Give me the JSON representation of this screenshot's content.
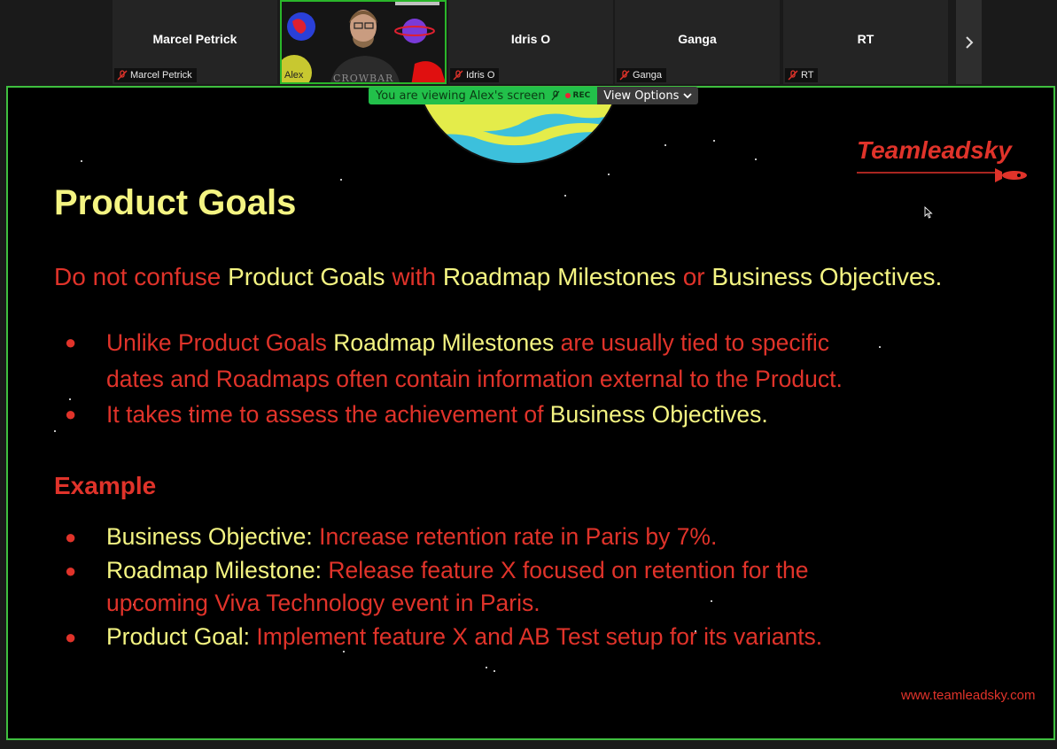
{
  "participants": [
    {
      "name": "Marcel Petrick",
      "tag": "Marcel Petrick"
    },
    {
      "name": "Alex",
      "tag": "Alex"
    },
    {
      "name": "Idris O",
      "tag": "Idris O"
    },
    {
      "name": "Ganga",
      "tag": "Ganga"
    },
    {
      "name": "RT",
      "tag": "RT"
    }
  ],
  "video_shirt_text": "CROWBAR",
  "banner": {
    "viewing": "You are viewing Alex's screen",
    "rec": "REC",
    "view_options": "View Options"
  },
  "slide": {
    "title": "Product Goals",
    "intro": [
      "Do not confuse ",
      "Product Goals",
      " with ",
      "Roadmap Milestones",
      " or ",
      "Business Objectives",
      "."
    ],
    "bullets1": [
      {
        "a": "Unlike Product Goals ",
        "b": "Roadmap Milestones",
        "c": " are usually tied to specific"
      },
      {
        "a": "dates and Roadmaps often contain information external to the Product."
      },
      {
        "a": "It takes time to assess the achievement of ",
        "b": "Business Objectives",
        "c": "."
      }
    ],
    "example_heading": "Example",
    "bullets2": [
      {
        "label": "Business Objective: ",
        "text": "Increase retention rate in Paris by 7%."
      },
      {
        "label": "Roadmap Milestone: ",
        "text": "Release feature X focused on retention for the"
      },
      {
        "cont": "upcoming Viva Technology event in Paris."
      },
      {
        "label": "Product Goal: ",
        "text": "Implement feature X and AB Test setup for its variants."
      }
    ],
    "logo": "Teamleadsky",
    "url": "www.teamleadsky.com"
  },
  "colors": {
    "red": "#e0332a",
    "yellow": "#f4f482",
    "green_border": "#3fbf3f",
    "banner_green": "#22c04a"
  }
}
